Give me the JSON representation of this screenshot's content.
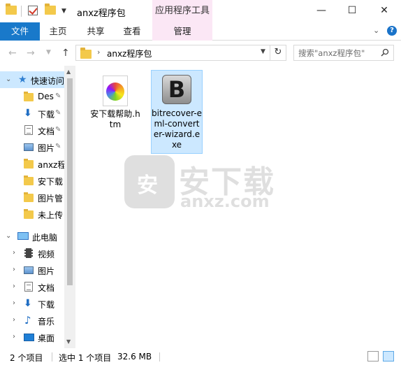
{
  "window": {
    "title": "anxz程序包",
    "contextual_tab_group": "应用程序工具",
    "minimize_glyph": "—",
    "maximize_glyph": "☐",
    "close_glyph": "✕"
  },
  "ribbon": {
    "tabs": [
      {
        "label": "文件"
      },
      {
        "label": "主页"
      },
      {
        "label": "共享"
      },
      {
        "label": "查看"
      },
      {
        "label": "管理"
      }
    ],
    "collapse_glyph": "⌄",
    "help_glyph": "?"
  },
  "address": {
    "path": "anxz程序包",
    "crumb_separator": "›",
    "search_placeholder": "搜索\"anxz程序包\""
  },
  "nav": {
    "quick_access": {
      "label": "快速访问",
      "icon": "star-icon"
    },
    "quick_items": [
      {
        "label": "Des",
        "icon": "folder-icon",
        "pinned": true
      },
      {
        "label": "下载",
        "icon": "download-icon",
        "pinned": true
      },
      {
        "label": "文档",
        "icon": "document-icon",
        "pinned": true
      },
      {
        "label": "图片",
        "icon": "picture-icon",
        "pinned": true
      },
      {
        "label": "anxz程",
        "icon": "folder-icon",
        "pinned": false
      },
      {
        "label": "安下载",
        "icon": "folder-icon",
        "pinned": false
      },
      {
        "label": "图片管",
        "icon": "folder-icon",
        "pinned": false
      },
      {
        "label": "未上传",
        "icon": "folder-icon",
        "pinned": false
      }
    ],
    "this_pc": {
      "label": "此电脑",
      "icon": "computer-icon"
    },
    "pc_items": [
      {
        "label": "视频",
        "icon": "video-icon"
      },
      {
        "label": "图片",
        "icon": "picture-icon"
      },
      {
        "label": "文档",
        "icon": "document-icon"
      },
      {
        "label": "下载",
        "icon": "download-icon"
      },
      {
        "label": "音乐",
        "icon": "music-icon"
      },
      {
        "label": "桌面",
        "icon": "desktop-icon"
      }
    ]
  },
  "files": [
    {
      "name": "安下载帮助.htm",
      "icon": "html-file-icon",
      "selected": false
    },
    {
      "name": "bitrecover-eml-converter-wizard.exe",
      "icon": "exe-app-icon",
      "icon_letter": "B",
      "selected": true
    }
  ],
  "watermark": {
    "text": "安下载",
    "sub": "anxz.com",
    "shield_char": "安"
  },
  "status": {
    "item_count": "2 个项目",
    "selection": "选中 1 个项目",
    "size": "32.6 MB"
  },
  "colors": {
    "file_tab": "#1979ca",
    "context_tab": "#fbe7f5",
    "selection": "#cce8ff"
  }
}
